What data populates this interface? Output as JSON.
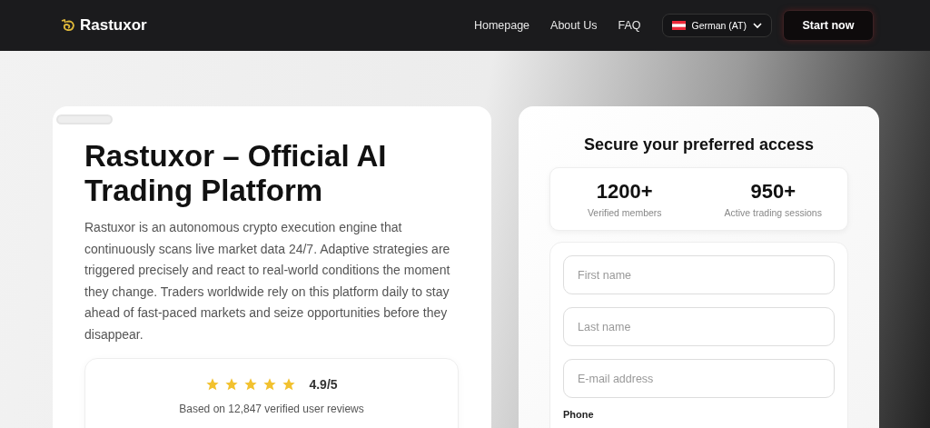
{
  "header": {
    "brand": "Rastuxor",
    "nav": [
      "Homepage",
      "About Us",
      "FAQ"
    ],
    "language": "German (AT)",
    "cta": "Start now"
  },
  "hero": {
    "title": "Rastuxor – Official AI Trading Platform",
    "description": "Rastuxor is an autonomous crypto execution engine that continuously scans live market data 24/7. Adaptive strategies are triggered precisely and react to real-world conditions the moment they change. Traders worldwide rely on this platform daily to stay ahead of fast-paced markets and seize opportunities before they disappear.",
    "rating": {
      "stars": 5,
      "score": "4.9/5",
      "caption": "Based on 12,847 verified user reviews"
    }
  },
  "form": {
    "title": "Secure your preferred access",
    "stats": [
      {
        "value": "1200+",
        "label": "Verified members"
      },
      {
        "value": "950+",
        "label": "Active trading sessions"
      }
    ],
    "fields": [
      {
        "placeholder": "First name"
      },
      {
        "placeholder": "Last name"
      },
      {
        "placeholder": "E-mail address"
      }
    ],
    "phone_label": "Phone"
  }
}
